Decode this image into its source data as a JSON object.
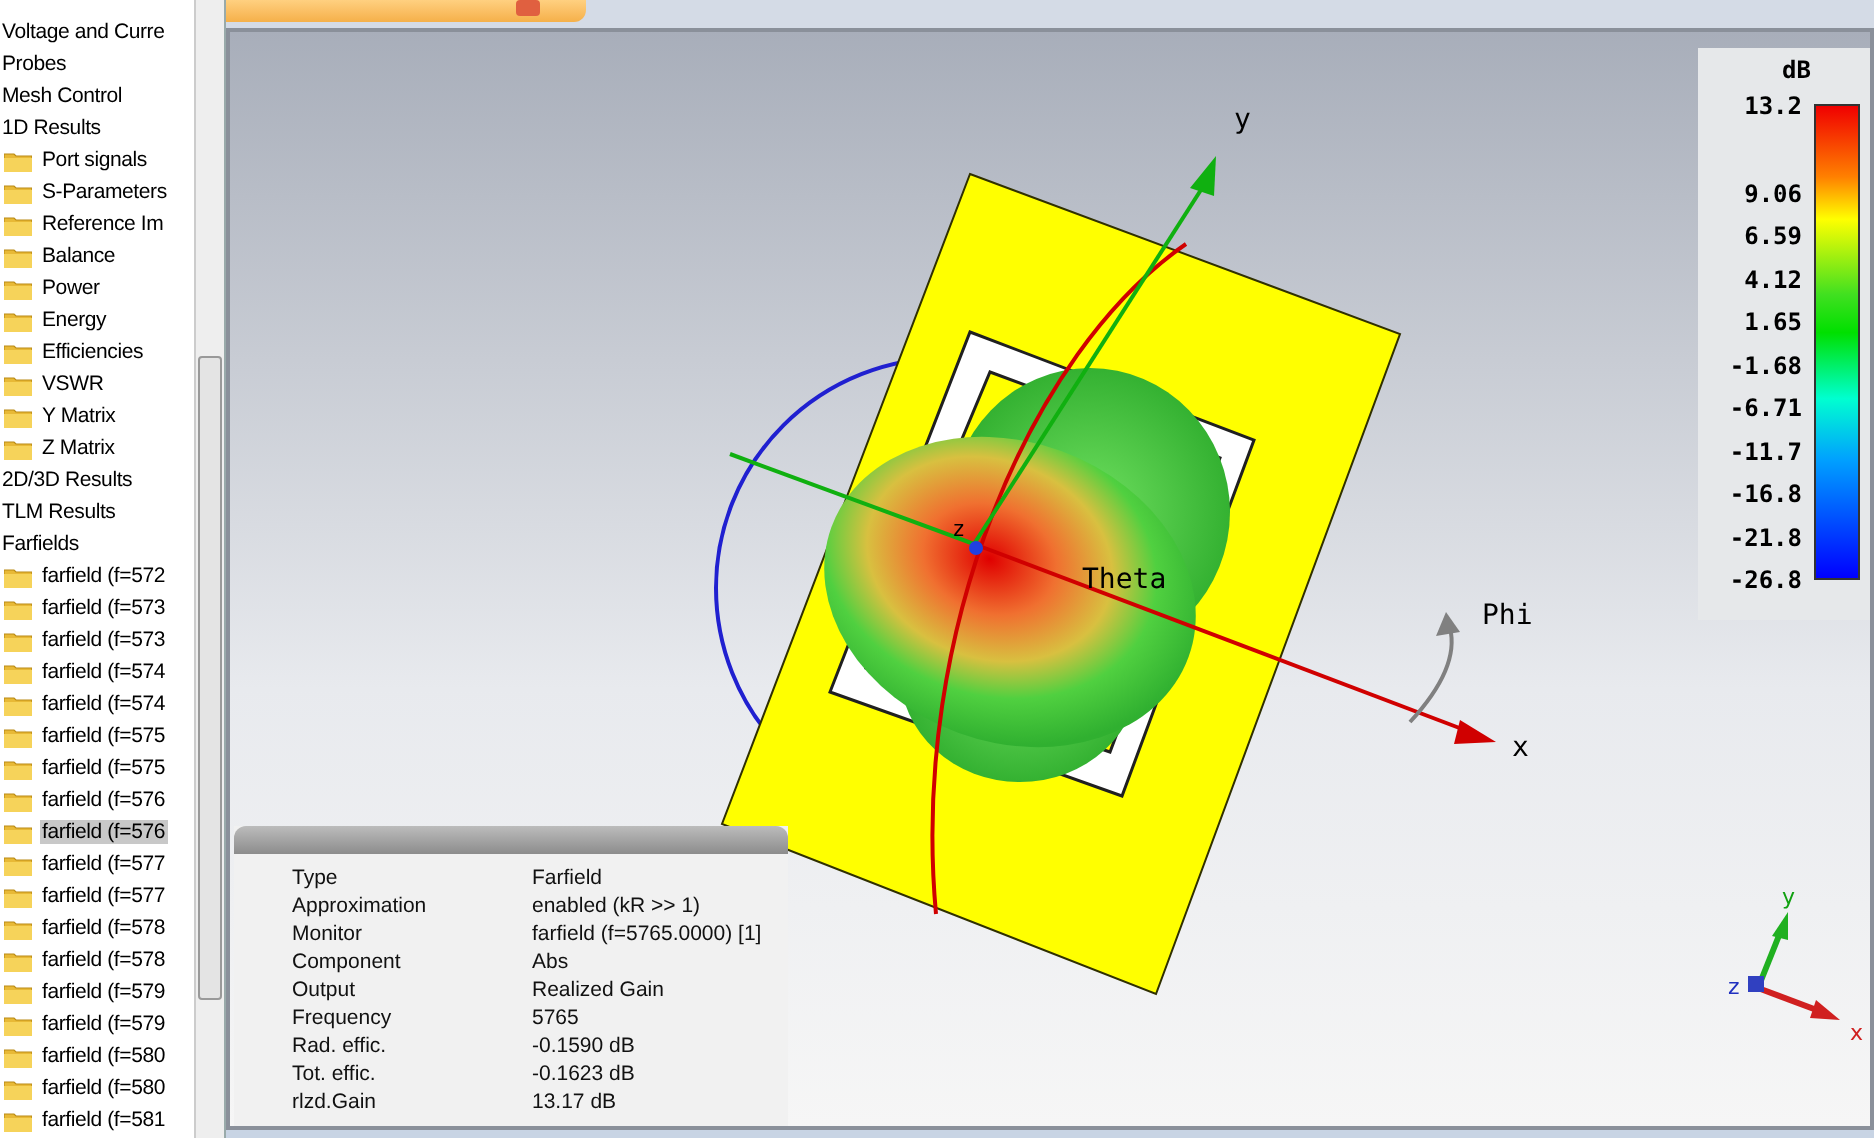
{
  "tree": {
    "items": [
      {
        "label": "Voltage and Curre",
        "folder": false,
        "selected": false
      },
      {
        "label": "Probes",
        "folder": false,
        "selected": false
      },
      {
        "label": "Mesh Control",
        "folder": false,
        "selected": false
      },
      {
        "label": "1D Results",
        "folder": false,
        "selected": false,
        "children": [
          {
            "label": "Port signals",
            "folder": true,
            "selected": false
          },
          {
            "label": "S-Parameters",
            "folder": true,
            "selected": false
          },
          {
            "label": "Reference Im",
            "folder": true,
            "selected": false
          },
          {
            "label": "Balance",
            "folder": true,
            "selected": false
          },
          {
            "label": "Power",
            "folder": true,
            "selected": false
          },
          {
            "label": "Energy",
            "folder": true,
            "selected": false
          },
          {
            "label": "Efficiencies",
            "folder": true,
            "selected": false
          },
          {
            "label": "VSWR",
            "folder": true,
            "selected": false
          },
          {
            "label": "Y Matrix",
            "folder": true,
            "selected": false
          },
          {
            "label": "Z Matrix",
            "folder": true,
            "selected": false
          }
        ]
      },
      {
        "label": "2D/3D Results",
        "folder": false,
        "selected": false
      },
      {
        "label": "TLM Results",
        "folder": false,
        "selected": false
      },
      {
        "label": "Farfields",
        "folder": false,
        "selected": false,
        "children": [
          {
            "label": "farfield (f=572",
            "folder": true,
            "selected": false
          },
          {
            "label": "farfield (f=573",
            "folder": true,
            "selected": false
          },
          {
            "label": "farfield (f=573",
            "folder": true,
            "selected": false
          },
          {
            "label": "farfield (f=574",
            "folder": true,
            "selected": false
          },
          {
            "label": "farfield (f=574",
            "folder": true,
            "selected": false
          },
          {
            "label": "farfield (f=575",
            "folder": true,
            "selected": false
          },
          {
            "label": "farfield (f=575",
            "folder": true,
            "selected": false
          },
          {
            "label": "farfield (f=576",
            "folder": true,
            "selected": false
          },
          {
            "label": "farfield (f=576",
            "folder": true,
            "selected": true
          },
          {
            "label": "farfield (f=577",
            "folder": true,
            "selected": false
          },
          {
            "label": "farfield (f=577",
            "folder": true,
            "selected": false
          },
          {
            "label": "farfield (f=578",
            "folder": true,
            "selected": false
          },
          {
            "label": "farfield (f=578",
            "folder": true,
            "selected": false
          },
          {
            "label": "farfield (f=579",
            "folder": true,
            "selected": false
          },
          {
            "label": "farfield (f=579",
            "folder": true,
            "selected": false
          },
          {
            "label": "farfield (f=580",
            "folder": true,
            "selected": false
          },
          {
            "label": "farfield (f=580",
            "folder": true,
            "selected": false
          },
          {
            "label": "farfield (f=581",
            "folder": true,
            "selected": false
          }
        ]
      }
    ]
  },
  "viewport": {
    "axis_labels": {
      "y": "y",
      "x": "x",
      "z": "z",
      "theta": "Theta",
      "phi": "Phi"
    },
    "triad_labels": {
      "x": "x",
      "y": "y",
      "z": "z"
    }
  },
  "legend": {
    "unit": "dB",
    "ticks": [
      "13.2",
      "9.06",
      "6.59",
      "4.12",
      "1.65",
      "-1.68",
      "-6.71",
      "-11.7",
      "-16.8",
      "-21.8",
      "-26.8"
    ]
  },
  "info": {
    "rows": [
      {
        "label": "Type",
        "value": "Farfield"
      },
      {
        "label": "Approximation",
        "value": "enabled (kR >> 1)"
      },
      {
        "label": "Monitor",
        "value": "farfield (f=5765.0000) [1]"
      },
      {
        "label": "Component",
        "value": "Abs"
      },
      {
        "label": "Output",
        "value": "Realized Gain"
      },
      {
        "label": "Frequency",
        "value": "5765"
      },
      {
        "label": "Rad. effic.",
        "value": "-0.1590 dB"
      },
      {
        "label": "Tot. effic.",
        "value": "-0.1623 dB"
      },
      {
        "label": "rlzd.Gain",
        "value": "13.17 dB"
      }
    ]
  }
}
